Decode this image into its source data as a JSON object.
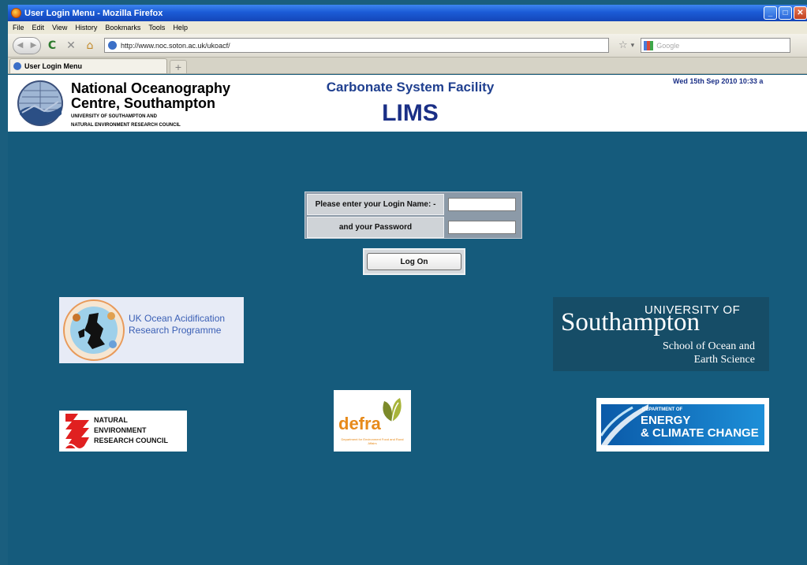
{
  "window": {
    "title": "User Login Menu - Mozilla Firefox",
    "controls": [
      "_",
      "□",
      "✕"
    ]
  },
  "menu": [
    "File",
    "Edit",
    "View",
    "History",
    "Bookmarks",
    "Tools",
    "Help"
  ],
  "nav": {
    "url": "http://www.noc.soton.ac.uk/ukoacf/",
    "search_placeholder": "Google"
  },
  "tabs": [
    {
      "label": "User Login Menu"
    }
  ],
  "header": {
    "org_name_line1": "National Oceanography",
    "org_name_line2": "Centre, Southampton",
    "org_sub_line1": "UNIVERSITY OF SOUTHAMPTON AND",
    "org_sub_line2": "NATURAL ENVIRONMENT RESEARCH COUNCIL",
    "facility": "Carbonate System Facility",
    "system": "LIMS",
    "datetime": "Wed 15th Sep 2010 10:33 a"
  },
  "login": {
    "name_label": "Please enter your Login Name: -",
    "password_label": "and your Password",
    "name_value": "",
    "password_value": "",
    "submit_label": "Log On"
  },
  "logos": {
    "ukoa": {
      "line1": "UK Ocean Acidification",
      "line2": "Research Programme"
    },
    "soton": {
      "univ": "UNIVERSITY OF",
      "name": "Southampton",
      "school1": "School of Ocean and",
      "school2": "Earth Science"
    },
    "nerc": {
      "line1": "NATURAL",
      "line2": "ENVIRONMENT",
      "line3": "RESEARCH COUNCIL"
    },
    "defra": {
      "name": "defra",
      "small": "Department for Environment Food and Rural Affairs"
    },
    "decc": {
      "line1": "DEPARTMENT OF",
      "line2": "ENERGY",
      "line3": "& CLIMATE CHANGE"
    }
  }
}
